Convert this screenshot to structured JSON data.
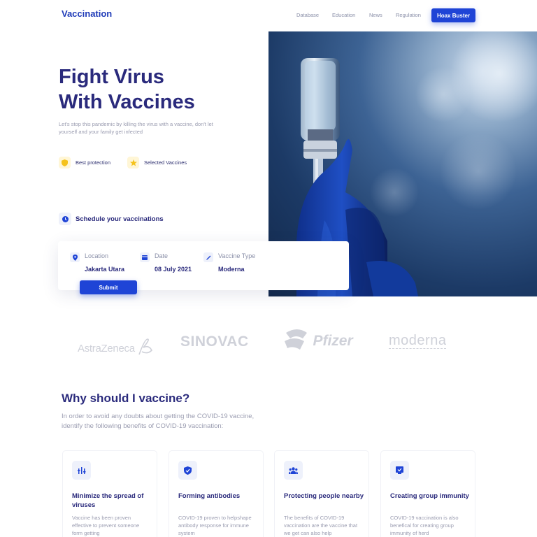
{
  "header": {
    "logo": "Vaccination",
    "nav": [
      "Database",
      "Education",
      "News",
      "Regulation"
    ],
    "cta": "Hoax Buster"
  },
  "hero": {
    "title_line1": "Fight Virus",
    "title_line2": "With Vaccines",
    "subtitle": "Let's stop this pandemic by killing the virus with a vaccine, don't let yourself and your family get infected",
    "features": [
      "Best protection",
      "Selected Vaccines"
    ]
  },
  "schedule": {
    "title": "Schedule your vaccinations",
    "location_label": "Location",
    "location_value": "Jakarta Utara",
    "date_label": "Date",
    "date_value": "08 July 2021",
    "vaccine_label": "Vaccine Type",
    "vaccine_value": "Moderna",
    "submit": "Submit"
  },
  "brands": [
    "AstraZeneca",
    "SINOVAC",
    "Pfizer",
    "moderna"
  ],
  "why": {
    "title": "Why should I vaccine?",
    "subtitle": "In order to avoid any doubts about getting the COVID-19 vaccine, identify the following benefits of COVID-19 vaccination:",
    "cards": [
      {
        "title": "Minimize the spread of viruses",
        "text": "Vaccine has been proven effective to prevent someone form getting"
      },
      {
        "title": "Forming antibodies",
        "text": "COVID-19 proven to helpshape antibody response for immune system"
      },
      {
        "title": "Protecting people nearby",
        "text": "The benefits of COVID-19 vaccination are the vaccine that we get can also help"
      },
      {
        "title": "Creating group immunity",
        "text": "COVID-19 vaccination is also benefical for creating group immunity of herd"
      }
    ]
  },
  "colors": {
    "primary": "#1f44d6",
    "heading": "#2a2a7c",
    "muted": "#9a9cb0",
    "star": "#f5c21b"
  }
}
